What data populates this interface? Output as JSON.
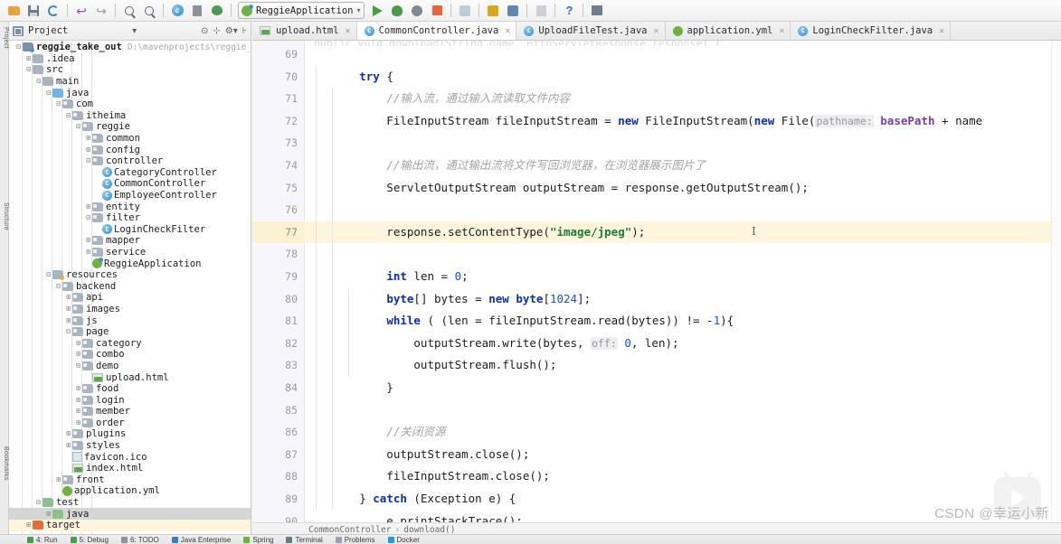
{
  "toolbar": {
    "buttons": [
      {
        "name": "open-folder-icon",
        "glyph": "folder"
      },
      {
        "name": "save-all-icon",
        "glyph": "save"
      },
      {
        "name": "sync-icon",
        "glyph": "sync"
      },
      {
        "name": "undo-icon",
        "glyph": "undo"
      },
      {
        "name": "redo-icon",
        "glyph": "redo"
      },
      {
        "name": "search-icon",
        "glyph": "search"
      },
      {
        "name": "search-everywhere-icon",
        "glyph": "search-struct"
      },
      {
        "name": "compile-icon",
        "glyph": "circle-c"
      },
      {
        "name": "book-icon",
        "glyph": "book"
      },
      {
        "name": "build-icon",
        "glyph": "bug-green"
      }
    ],
    "run_config": "ReggieApplication",
    "run_config_caret": "▾",
    "right_buttons": [
      {
        "name": "run-button",
        "glyph": "play"
      },
      {
        "name": "debug-button",
        "glyph": "debug"
      },
      {
        "name": "run-with-coverage-button",
        "glyph": "coverage"
      },
      {
        "name": "stop-button",
        "glyph": "stop"
      },
      {
        "name": "profiler-button",
        "glyph": "profiler"
      },
      {
        "name": "settings-button",
        "glyph": "wrench"
      },
      {
        "name": "project-structure-button",
        "glyph": "structure"
      },
      {
        "name": "update-project-button",
        "glyph": "update"
      },
      {
        "name": "help-button",
        "glyph": "question"
      },
      {
        "name": "restore-layout-button",
        "glyph": "window"
      }
    ],
    "help_label": "?"
  },
  "left_rail": {
    "labels": [
      "Project",
      "Structure",
      "Bookmarks"
    ]
  },
  "project_panel": {
    "title": "Project",
    "caret": "▾",
    "header_icons": [
      "target-icon",
      "collapse-all-icon",
      "settings-gear-icon",
      "hide-icon"
    ],
    "tree": [
      {
        "depth": 0,
        "twist": "−",
        "icon": "folder-proj",
        "label": "reggie_take_out",
        "bold": true,
        "path": "D:\\mavenprojects\\reggie_take_o"
      },
      {
        "depth": 1,
        "twist": "+",
        "icon": "folder",
        "label": ".idea"
      },
      {
        "depth": 1,
        "twist": "−",
        "icon": "folder",
        "label": "src"
      },
      {
        "depth": 2,
        "twist": "−",
        "icon": "folder",
        "label": "main"
      },
      {
        "depth": 3,
        "twist": "−",
        "icon": "java-src",
        "label": "java"
      },
      {
        "depth": 4,
        "twist": "−",
        "icon": "pkg",
        "label": "com"
      },
      {
        "depth": 5,
        "twist": "−",
        "icon": "pkg",
        "label": "itheima"
      },
      {
        "depth": 6,
        "twist": "−",
        "icon": "pkg",
        "label": "reggie"
      },
      {
        "depth": 7,
        "twist": "+",
        "icon": "pkg",
        "label": "common"
      },
      {
        "depth": 7,
        "twist": "+",
        "icon": "pkg",
        "label": "config"
      },
      {
        "depth": 7,
        "twist": "−",
        "icon": "pkg",
        "label": "controller"
      },
      {
        "depth": 8,
        "twist": "",
        "icon": "class",
        "label": "CategoryController"
      },
      {
        "depth": 8,
        "twist": "",
        "icon": "class",
        "label": "CommonController"
      },
      {
        "depth": 8,
        "twist": "",
        "icon": "class",
        "label": "EmployeeController"
      },
      {
        "depth": 7,
        "twist": "+",
        "icon": "pkg",
        "label": "entity"
      },
      {
        "depth": 7,
        "twist": "−",
        "icon": "pkg",
        "label": "filter"
      },
      {
        "depth": 8,
        "twist": "",
        "icon": "class",
        "label": "LoginCheckFilter"
      },
      {
        "depth": 7,
        "twist": "+",
        "icon": "pkg",
        "label": "mapper"
      },
      {
        "depth": 7,
        "twist": "+",
        "icon": "pkg",
        "label": "service"
      },
      {
        "depth": 7,
        "twist": "",
        "icon": "spring",
        "label": "ReggieApplication"
      },
      {
        "depth": 3,
        "twist": "−",
        "icon": "folder-res",
        "label": "resources"
      },
      {
        "depth": 4,
        "twist": "−",
        "icon": "pkg",
        "label": "backend"
      },
      {
        "depth": 5,
        "twist": "+",
        "icon": "pkg",
        "label": "api"
      },
      {
        "depth": 5,
        "twist": "+",
        "icon": "pkg",
        "label": "images"
      },
      {
        "depth": 5,
        "twist": "+",
        "icon": "pkg",
        "label": "js"
      },
      {
        "depth": 5,
        "twist": "−",
        "icon": "pkg",
        "label": "page"
      },
      {
        "depth": 6,
        "twist": "+",
        "icon": "pkg",
        "label": "category"
      },
      {
        "depth": 6,
        "twist": "+",
        "icon": "pkg",
        "label": "combo"
      },
      {
        "depth": 6,
        "twist": "−",
        "icon": "pkg",
        "label": "demo"
      },
      {
        "depth": 7,
        "twist": "",
        "icon": "html",
        "label": "upload.html"
      },
      {
        "depth": 6,
        "twist": "+",
        "icon": "pkg",
        "label": "food"
      },
      {
        "depth": 6,
        "twist": "+",
        "icon": "pkg",
        "label": "login"
      },
      {
        "depth": 6,
        "twist": "+",
        "icon": "pkg",
        "label": "member"
      },
      {
        "depth": 6,
        "twist": "+",
        "icon": "pkg",
        "label": "order"
      },
      {
        "depth": 5,
        "twist": "+",
        "icon": "pkg",
        "label": "plugins"
      },
      {
        "depth": 5,
        "twist": "+",
        "icon": "pkg",
        "label": "styles"
      },
      {
        "depth": 5,
        "twist": "",
        "icon": "ico",
        "label": "favicon.ico"
      },
      {
        "depth": 5,
        "twist": "",
        "icon": "html",
        "label": "index.html"
      },
      {
        "depth": 4,
        "twist": "+",
        "icon": "pkg",
        "label": "front"
      },
      {
        "depth": 4,
        "twist": "",
        "icon": "yml",
        "label": "application.yml"
      },
      {
        "depth": 2,
        "twist": "−",
        "icon": "folder-test",
        "label": "test"
      },
      {
        "depth": 3,
        "twist": "+",
        "icon": "folder-test",
        "label": "java",
        "selected": true
      },
      {
        "depth": 1,
        "twist": "+",
        "icon": "folder-tgt",
        "label": "target",
        "highlighted": true
      }
    ]
  },
  "tabs": [
    {
      "label": "upload.html",
      "icon": "html-file-icon",
      "active": false,
      "close": "✕"
    },
    {
      "label": "CommonController.java",
      "icon": "java-class-icon",
      "active": true,
      "close": "✕"
    },
    {
      "label": "UploadFileTest.java",
      "icon": "java-class-icon",
      "active": false,
      "close": "✕"
    },
    {
      "label": "application.yml",
      "icon": "yml-file-icon",
      "active": false,
      "close": "✕"
    },
    {
      "label": "LoginCheckFilter.java",
      "icon": "java-class-icon",
      "active": false,
      "close": "✕"
    }
  ],
  "editor": {
    "first_line": 69,
    "highlight_line": 77,
    "lines": [
      {
        "n": 69,
        "segments": []
      },
      {
        "n": 70,
        "segments": [
          {
            "t": "        ",
            "c": ""
          },
          {
            "t": "try",
            "c": "kw"
          },
          {
            "t": " {",
            "c": ""
          }
        ]
      },
      {
        "n": 71,
        "segments": [
          {
            "t": "            ",
            "c": ""
          },
          {
            "t": "//输入流，通过输入流读取文件内容",
            "c": "cmt"
          }
        ]
      },
      {
        "n": 72,
        "segments": [
          {
            "t": "            FileInputStream fileInputStream = ",
            "c": ""
          },
          {
            "t": "new",
            "c": "kw"
          },
          {
            "t": " FileInputStream(",
            "c": ""
          },
          {
            "t": "new",
            "c": "kw"
          },
          {
            "t": " File(",
            "c": ""
          },
          {
            "t": "pathname:",
            "c": "hint"
          },
          {
            "t": " ",
            "c": ""
          },
          {
            "t": "basePath",
            "c": "fld"
          },
          {
            "t": " + name",
            "c": ""
          }
        ]
      },
      {
        "n": 73,
        "segments": []
      },
      {
        "n": 74,
        "segments": [
          {
            "t": "            ",
            "c": ""
          },
          {
            "t": "//输出流，通过输出流将文件写回浏览器，在浏览器展示图片了",
            "c": "cmt"
          }
        ]
      },
      {
        "n": 75,
        "segments": [
          {
            "t": "            ServletOutputStream outputStream = response.getOutputStream();",
            "c": ""
          }
        ]
      },
      {
        "n": 76,
        "segments": []
      },
      {
        "n": 77,
        "segments": [
          {
            "t": "            response.setContentType(",
            "c": ""
          },
          {
            "t": "\"image/jpeg\"",
            "c": "str"
          },
          {
            "t": ");",
            "c": ""
          }
        ]
      },
      {
        "n": 78,
        "segments": []
      },
      {
        "n": 79,
        "segments": [
          {
            "t": "            ",
            "c": ""
          },
          {
            "t": "int",
            "c": "kw"
          },
          {
            "t": " len = ",
            "c": ""
          },
          {
            "t": "0",
            "c": "num"
          },
          {
            "t": ";",
            "c": ""
          }
        ]
      },
      {
        "n": 80,
        "segments": [
          {
            "t": "            ",
            "c": ""
          },
          {
            "t": "byte",
            "c": "kw"
          },
          {
            "t": "[] bytes = ",
            "c": ""
          },
          {
            "t": "new",
            "c": "kw"
          },
          {
            "t": " ",
            "c": ""
          },
          {
            "t": "byte",
            "c": "kw"
          },
          {
            "t": "[",
            "c": ""
          },
          {
            "t": "1024",
            "c": "num"
          },
          {
            "t": "];",
            "c": ""
          }
        ]
      },
      {
        "n": 81,
        "segments": [
          {
            "t": "            ",
            "c": ""
          },
          {
            "t": "while",
            "c": "kw"
          },
          {
            "t": " ( (len = fileInputStream.read(bytes)) != -",
            "c": ""
          },
          {
            "t": "1",
            "c": "num"
          },
          {
            "t": "){",
            "c": ""
          }
        ]
      },
      {
        "n": 82,
        "segments": [
          {
            "t": "                outputStream.write(bytes, ",
            "c": ""
          },
          {
            "t": "off:",
            "c": "hint"
          },
          {
            "t": " ",
            "c": ""
          },
          {
            "t": "0",
            "c": "num"
          },
          {
            "t": ", len);",
            "c": ""
          }
        ]
      },
      {
        "n": 83,
        "segments": [
          {
            "t": "                outputStream.flush();",
            "c": ""
          }
        ]
      },
      {
        "n": 84,
        "segments": [
          {
            "t": "            }",
            "c": ""
          }
        ]
      },
      {
        "n": 85,
        "segments": []
      },
      {
        "n": 86,
        "segments": [
          {
            "t": "            ",
            "c": ""
          },
          {
            "t": "//关闭资源",
            "c": "cmt"
          }
        ]
      },
      {
        "n": 87,
        "segments": [
          {
            "t": "            outputStream.close();",
            "c": ""
          }
        ]
      },
      {
        "n": 88,
        "segments": [
          {
            "t": "            fileInputStream.close();",
            "c": ""
          }
        ]
      },
      {
        "n": 89,
        "segments": [
          {
            "t": "        } ",
            "c": ""
          },
          {
            "t": "catch",
            "c": "kw"
          },
          {
            "t": " (Exception e) {",
            "c": ""
          }
        ]
      },
      {
        "n": 90,
        "segments": [
          {
            "t": "            e.printStackTrace();",
            "c": ""
          }
        ]
      }
    ]
  },
  "breadcrumb": {
    "class": "CommonController",
    "separator": "›",
    "method": "download()"
  },
  "bottom_bar": {
    "items": [
      {
        "label": "4: Run",
        "color": "#4a9b4a"
      },
      {
        "label": "5: Debug",
        "color": "#4a9b4a"
      },
      {
        "label": "6: TODO",
        "color": "#8a939b"
      },
      {
        "label": "Java Enterprise",
        "color": "#3d7cc9"
      },
      {
        "label": "Spring",
        "color": "#6db33f"
      },
      {
        "label": "Terminal",
        "color": "#6b7983"
      },
      {
        "label": "Problems",
        "color": "#9aa3aa"
      },
      {
        "label": "Docker",
        "color": "#2496ed"
      }
    ]
  },
  "watermark": {
    "text": "CSDN @幸运小新"
  },
  "colors": {
    "keyword": "#0a2dbb",
    "string": "#177e3a",
    "comment": "#a3a3a3",
    "number": "#1c4fdd",
    "field": "#7a3ea3",
    "highlight_line": "#fdf6dd",
    "accent": "#3d7cc9"
  }
}
